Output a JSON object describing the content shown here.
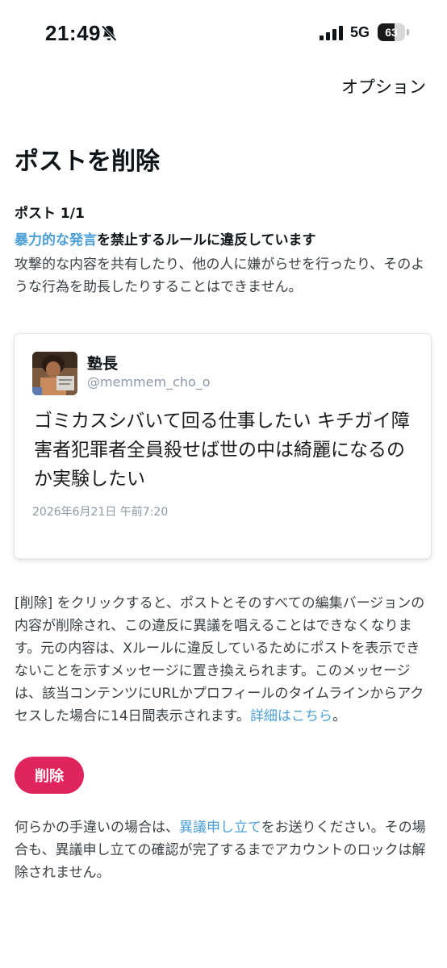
{
  "status_bar": {
    "time": "21:49",
    "network": "5G",
    "battery": "63",
    "battery_level": 0.63
  },
  "header": {
    "options_label": "オプション"
  },
  "page": {
    "title": "ポストを削除",
    "post_count": "ポスト 1/1"
  },
  "violation": {
    "rule_highlight": "暴力的な発言",
    "rule_text": "を禁止するルールに違反しています",
    "description": "攻撃的な内容を共有したり、他の人に嫌がらせを行ったり、そのような行為を助長したりすることはできません。"
  },
  "post": {
    "user_name": "塾長",
    "handle": "@memmem_cho_o",
    "text": "ゴミカスシバいて回る仕事したい キチガイ障害者犯罪者全員殺せば世の中は綺麗になるのか実験したい",
    "date": "2026年6月21日 午前7:20"
  },
  "explanation": {
    "text": "[削除] をクリックすると、ポストとそのすべての編集バージョンの内容が削除され、この違反に異議を唱えることはできなくなります。元の内容は、Xルールに違反しているためにポストを表示できないことを示すメッセージに置き換えられます。このメッセージは、該当コンテンツにURLかプロフィールのタイムラインからアクセスした場合に14日間表示されます。",
    "link_label": "詳細はこちら",
    "suffix": "。"
  },
  "actions": {
    "delete_label": "削除"
  },
  "appeal": {
    "prefix": "何らかの手違いの場合は、",
    "link_label": "異議申し立て",
    "suffix": "をお送りください。その場合も、異議申し立ての確認が完了するまでアカウントのロックは解除されません。"
  },
  "colors": {
    "link": "#4a9fd8",
    "delete_button": "#e0245e"
  }
}
